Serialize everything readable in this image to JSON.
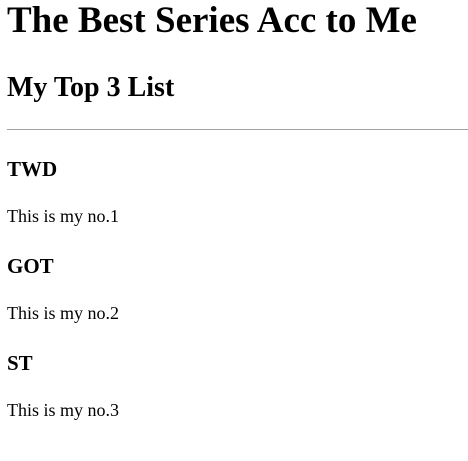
{
  "page": {
    "title": "The Best Series Acc to Me",
    "subtitle": "My Top 3 List"
  },
  "list": {
    "items": [
      {
        "title": "TWD",
        "text": "This is my no.1"
      },
      {
        "title": "GOT",
        "text": "This is my no.2"
      },
      {
        "title": "ST",
        "text": "This is my no.3"
      }
    ]
  }
}
